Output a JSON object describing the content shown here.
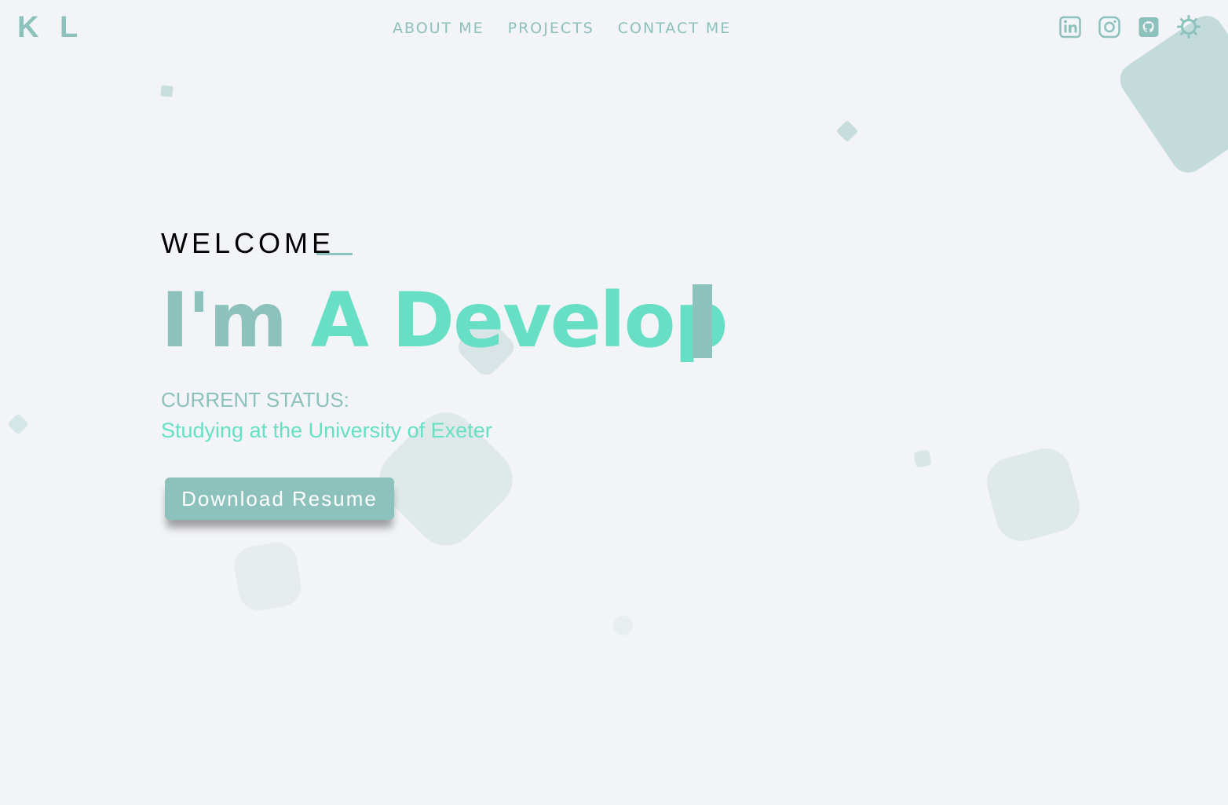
{
  "brand": {
    "logo": "K L"
  },
  "nav": {
    "items": [
      {
        "label": "ABOUT ME"
      },
      {
        "label": "PROJECTS"
      },
      {
        "label": "CONTACT ME"
      }
    ]
  },
  "socials": {
    "icons": [
      "linkedin-icon",
      "instagram-icon",
      "github-icon",
      "theme-toggle-sun-icon"
    ]
  },
  "hero": {
    "welcome": "WELCOME",
    "headline_prefix": "I'm ",
    "headline_typed": "A Develop",
    "status_label": "CURRENT STATUS:",
    "status_value": "Studying at the University of Exeter",
    "resume_button": "Download Resume"
  },
  "colors": {
    "background": "#f2f4f8",
    "accent_muted": "#8dc1bb",
    "accent_bright": "#66dfc4",
    "text_dark": "#000000",
    "button_text": "#ffffff"
  }
}
